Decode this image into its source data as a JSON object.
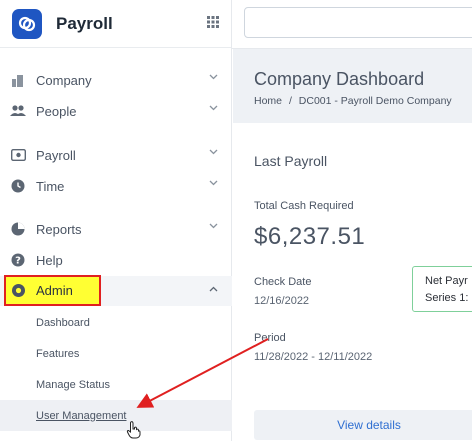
{
  "app": {
    "title": "Payroll"
  },
  "sidebar": {
    "items": [
      {
        "label": "Company",
        "icon": "building-icon",
        "chevron": true
      },
      {
        "label": "People",
        "icon": "people-icon",
        "chevron": true
      },
      {
        "label": "Payroll",
        "icon": "payroll-icon",
        "chevron": true
      },
      {
        "label": "Time",
        "icon": "clock-icon",
        "chevron": true
      },
      {
        "label": "Reports",
        "icon": "pie-chart-icon",
        "chevron": true
      },
      {
        "label": "Help",
        "icon": "help-icon",
        "chevron": false
      },
      {
        "label": "Admin",
        "icon": "admin-icon",
        "chevron": true,
        "expanded": true
      }
    ],
    "admin_sub": [
      "Dashboard",
      "Features",
      "Manage Status",
      "User Management"
    ]
  },
  "search": {
    "placeholder": ""
  },
  "dashboard": {
    "title": "Company Dashboard",
    "breadcrumb": {
      "home": "Home",
      "sep": "/",
      "company": "DC001 - Payroll Demo Company"
    }
  },
  "last_payroll": {
    "title": "Last Payroll",
    "total_cash_label": "Total Cash Required",
    "total_cash_value": "$6,237.51",
    "check_date_label": "Check Date",
    "check_date_value": "12/16/2022",
    "period_label": "Period",
    "period_value": "11/28/2022 - 12/11/2022",
    "view_details": "View details"
  },
  "tooltip": {
    "line1": "Net Payr",
    "line2": "Series 1:"
  },
  "colors": {
    "brand": "#1f56c2",
    "highlight": "#ffff33",
    "annotation": "#e02020",
    "link": "#2f6fd1",
    "tooltip_border": "#7fd09a"
  }
}
